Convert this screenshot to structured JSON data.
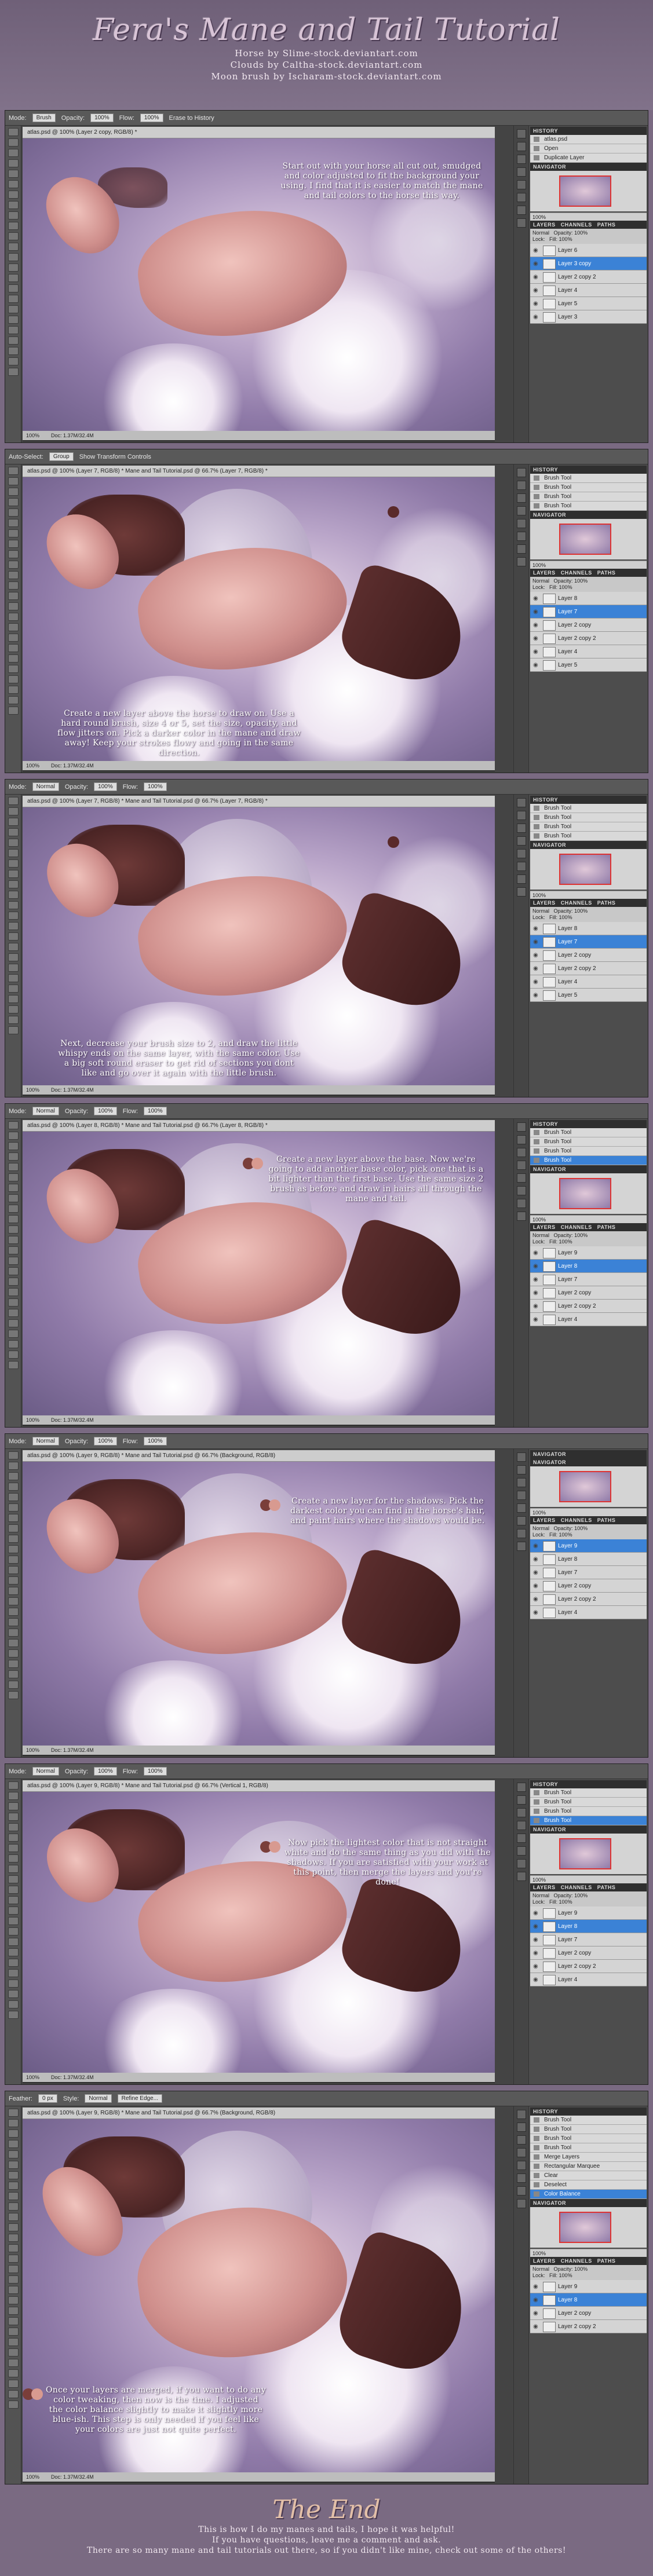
{
  "header": {
    "title": "Fera's Mane and Tail Tutorial",
    "credits": [
      "Horse by Slime-stock.deviantart.com",
      "Clouds by Caltha-stock.deviantart.com",
      "Moon brush by Ischaram-stock.deviantart.com"
    ]
  },
  "panels": [
    {
      "options": [
        "Mode:",
        "Brush",
        "Opacity:",
        "100%",
        "Flow:",
        "100%",
        "Erase to History"
      ],
      "doc_tab": "atlas.psd @ 100% (Layer 2 copy, RGB/8) *",
      "note": "Start out with your horse all cut out, smudged and color adjusted to fit the background your using. I find that it is easier to match the mane and tail colors to the horse this way.",
      "status": [
        "100%",
        "Doc: 1.37M/32.4M"
      ],
      "history_title": "HISTORY",
      "history": [
        "atlas.psd",
        "Open",
        "Duplicate Layer"
      ],
      "layers": [
        "Layer 6",
        "Layer 3 copy",
        "Layer 2 copy 2",
        "Layer 4",
        "Layer 5",
        "Layer 3"
      ],
      "sel_layer": 1
    },
    {
      "options": [
        "Auto-Select:",
        "Group",
        "Show Transform Controls"
      ],
      "doc_tab": "atlas.psd @ 100% (Layer 7, RGB/8) *    Mane and Tail Tutorial.psd @ 66.7% (Layer 7, RGB/8) *",
      "note": "Create a new layer above the horse to draw on. Use a hard round brush, size 4 or 5, set the size, opacity, and flow jitters on. Pick a darker color in the mane and draw away! Keep your strokes flowy and going in the same direction.",
      "status": [
        "100%",
        "Doc: 1.37M/32.4M"
      ],
      "history_title": "HISTORY",
      "history": [
        "Brush Tool",
        "Brush Tool",
        "Brush Tool",
        "Brush Tool"
      ],
      "layers": [
        "Layer 8",
        "Layer 7",
        "Layer 2 copy",
        "Layer 2 copy 2",
        "Layer 4",
        "Layer 5"
      ],
      "sel_layer": 1
    },
    {
      "options": [
        "Mode:",
        "Normal",
        "Opacity:",
        "100%",
        "Flow:",
        "100%"
      ],
      "doc_tab": "atlas.psd @ 100% (Layer 7, RGB/8) *    Mane and Tail Tutorial.psd @ 66.7% (Layer 7, RGB/8) *",
      "note": "Next, decrease your brush size to 2, and draw the little whispy ends on the same layer, with the same color. Use a big soft round eraser to get rid of sections you dont like and go over it again with the little brush.",
      "status": [
        "100%",
        "Doc: 1.37M/32.4M"
      ],
      "history_title": "HISTORY",
      "history": [
        "Brush Tool",
        "Brush Tool",
        "Brush Tool",
        "Brush Tool"
      ],
      "layers": [
        "Layer 8",
        "Layer 7",
        "Layer 2 copy",
        "Layer 2 copy 2",
        "Layer 4",
        "Layer 5"
      ],
      "sel_layer": 1
    },
    {
      "options": [
        "Mode:",
        "Normal",
        "Opacity:",
        "100%",
        "Flow:",
        "100%"
      ],
      "doc_tab": "atlas.psd @ 100% (Layer 8, RGB/8) *    Mane and Tail Tutorial.psd @ 66.7% (Layer 8, RGB/8) *",
      "note": "Create a new layer above the base. Now we're going to add another base color, pick one that is a bit lighter than the first base. Use the same size 2 brush as before and draw in hairs all through the mane and tail.",
      "status": [
        "100%",
        "Doc: 1.37M/32.4M"
      ],
      "history_title": "HISTORY",
      "history": [
        "Brush Tool",
        "Brush Tool",
        "Brush Tool",
        "Brush Tool"
      ],
      "layers": [
        "Layer 9",
        "Layer 8",
        "Layer 7",
        "Layer 2 copy",
        "Layer 2 copy 2",
        "Layer 4"
      ],
      "sel_layer": 1
    },
    {
      "options": [
        "Mode:",
        "Normal",
        "Opacity:",
        "100%",
        "Flow:",
        "100%"
      ],
      "doc_tab": "atlas.psd @ 100% (Layer 9, RGB/8) *    Mane and Tail Tutorial.psd @ 66.7% (Background, RGB/8)",
      "note": "Create a new layer for the shadows. Pick the darkest color you can find in the horse's hair, and paint hairs where the shadows would be.",
      "status": [
        "100%",
        "Doc: 1.37M/32.4M"
      ],
      "history_title": "NAVIGATOR",
      "history": [],
      "layers": [
        "Layer 9",
        "Layer 8",
        "Layer 7",
        "Layer 2 copy",
        "Layer 2 copy 2",
        "Layer 4"
      ],
      "sel_layer": 0
    },
    {
      "options": [
        "Mode:",
        "Normal",
        "Opacity:",
        "100%",
        "Flow:",
        "100%"
      ],
      "doc_tab": "atlas.psd @ 100% (Layer 9, RGB/8) *    Mane and Tail Tutorial.psd @ 66.7% (Vertical 1, RGB/8)",
      "note": "Now pick the lightest color that is not straight white and do the same thing as you did with the shadows. If you are satisfied with your work at this point, then merge the layers and you're done!",
      "status": [
        "100%",
        "Doc: 1.37M/32.4M"
      ],
      "history_title": "HISTORY",
      "history": [
        "Brush Tool",
        "Brush Tool",
        "Brush Tool",
        "Brush Tool"
      ],
      "layers": [
        "Layer 9",
        "Layer 8",
        "Layer 7",
        "Layer 2 copy",
        "Layer 2 copy 2",
        "Layer 4"
      ],
      "sel_layer": 1
    },
    {
      "options": [
        "Feather:",
        "0 px",
        "Style:",
        "Normal",
        "Refine Edge..."
      ],
      "doc_tab": "atlas.psd @ 100% (Layer 9, RGB/8) *    Mane and Tail Tutorial.psd @ 66.7% (Background, RGB/8)",
      "note": "Once your layers are merged, if you want to do any color tweaking, then now is the time. I adjusted the color balance slightly to make it slightly more blue-ish. This step is only needed if you feel like your colors are just not quite perfect.",
      "status": [
        "100%",
        "Doc: 1.37M/32.4M"
      ],
      "history_title": "HISTORY",
      "history": [
        "Brush Tool",
        "Brush Tool",
        "Brush Tool",
        "Brush Tool",
        "Merge Layers",
        "Rectangular Marquee",
        "Clear",
        "Deselect",
        "Color Balance"
      ],
      "layers": [
        "Layer 9",
        "Layer 8",
        "Layer 2 copy",
        "Layer 2 copy 2"
      ],
      "sel_layer": 1
    }
  ],
  "footer": {
    "title": "The End",
    "lines": [
      "This is how I do my manes and tails, I hope it was helpful!",
      "If you have questions, leave me a comment and ask.",
      "There are so many mane and tail tutorials out there, so if you didn't like mine, check out some of the others!"
    ]
  },
  "labels": {
    "navigator": "NAVIGATOR",
    "layers": "LAYERS",
    "channels": "CHANNELS",
    "paths": "PATHS",
    "normal": "Normal",
    "opacity": "Opacity:",
    "opacity_val": "100%",
    "lock": "Lock:",
    "fill": "Fill:",
    "fill_val": "100%",
    "zoom": "100%"
  }
}
